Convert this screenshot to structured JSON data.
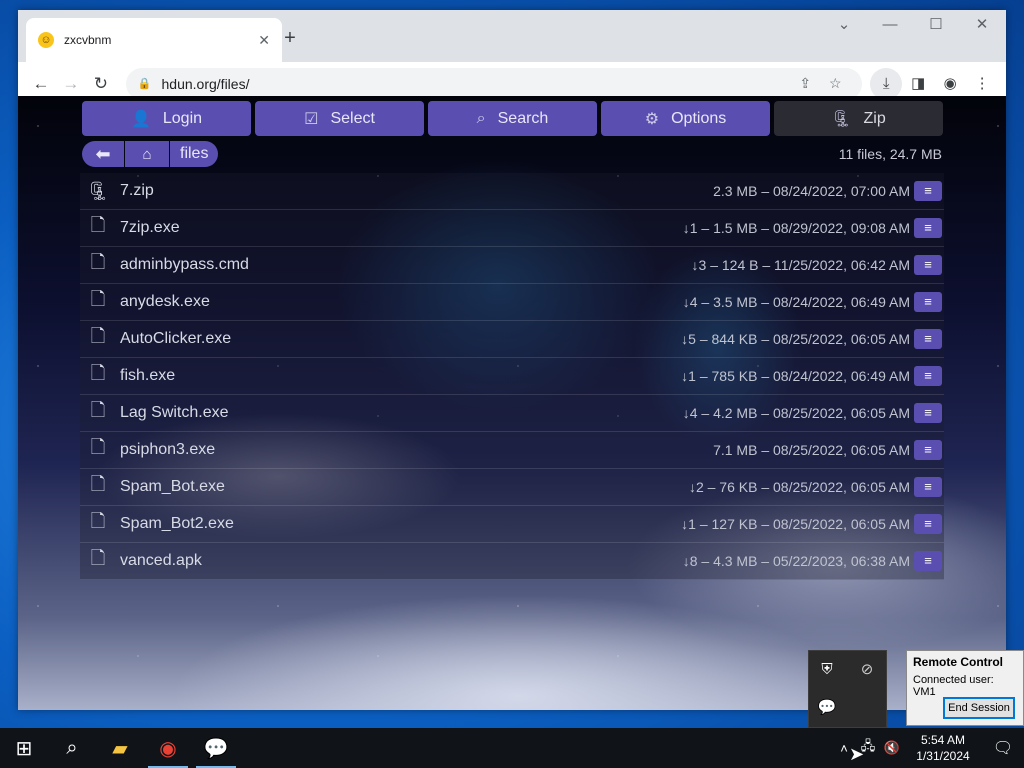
{
  "browser": {
    "tab_title": "zxcvbnm",
    "tab_favicon": "smiley-icon",
    "url": "hdun.org/files/"
  },
  "app": {
    "actions": [
      {
        "label": "Login",
        "icon": "user-icon"
      },
      {
        "label": "Select",
        "icon": "checkbox-icon"
      },
      {
        "label": "Search",
        "icon": "search-icon"
      },
      {
        "label": "Options",
        "icon": "gear-icon"
      },
      {
        "label": "Zip",
        "icon": "zip-file-icon"
      }
    ],
    "breadcrumb": {
      "folder": "files"
    },
    "summary": "11 files, 24.7 MB",
    "files": [
      {
        "name": "7.zip",
        "meta": "2.3 MB – 08/24/2022, 07:00 AM",
        "icon": "zip-file-icon"
      },
      {
        "name": "7zip.exe",
        "meta": "↓1 – 1.5 MB – 08/29/2022, 09:08 AM",
        "icon": "file-icon"
      },
      {
        "name": "adminbypass.cmd",
        "meta": "↓3 – 124 B – 11/25/2022, 06:42 AM",
        "icon": "file-icon"
      },
      {
        "name": "anydesk.exe",
        "meta": "↓4 – 3.5 MB – 08/24/2022, 06:49 AM",
        "icon": "file-icon"
      },
      {
        "name": "AutoClicker.exe",
        "meta": "↓5 – 844 KB – 08/25/2022, 06:05 AM",
        "icon": "file-icon"
      },
      {
        "name": "fish.exe",
        "meta": "↓1 – 785 KB – 08/24/2022, 06:49 AM",
        "icon": "file-icon"
      },
      {
        "name": "Lag Switch.exe",
        "meta": "↓4 – 4.2 MB – 08/25/2022, 06:05 AM",
        "icon": "file-icon"
      },
      {
        "name": "psiphon3.exe",
        "meta": "7.1 MB – 08/25/2022, 06:05 AM",
        "icon": "file-icon"
      },
      {
        "name": "Spam_Bot.exe",
        "meta": "↓2 – 76 KB – 08/25/2022, 06:05 AM",
        "icon": "file-icon"
      },
      {
        "name": "Spam_Bot2.exe",
        "meta": "↓1 – 127 KB – 08/25/2022, 06:05 AM",
        "icon": "file-icon"
      },
      {
        "name": "vanced.apk",
        "meta": "↓8 – 4.3 MB – 05/22/2023, 06:38 AM",
        "icon": "file-icon"
      }
    ]
  },
  "remote_control": {
    "title": "Remote Control",
    "user": "Connected user:  VM1",
    "end_button": "End Session"
  },
  "taskbar": {
    "time": "5:54 AM",
    "date": "1/31/2024"
  },
  "colors": {
    "accent": "#5a4fb0",
    "taskbar": "#101418"
  }
}
